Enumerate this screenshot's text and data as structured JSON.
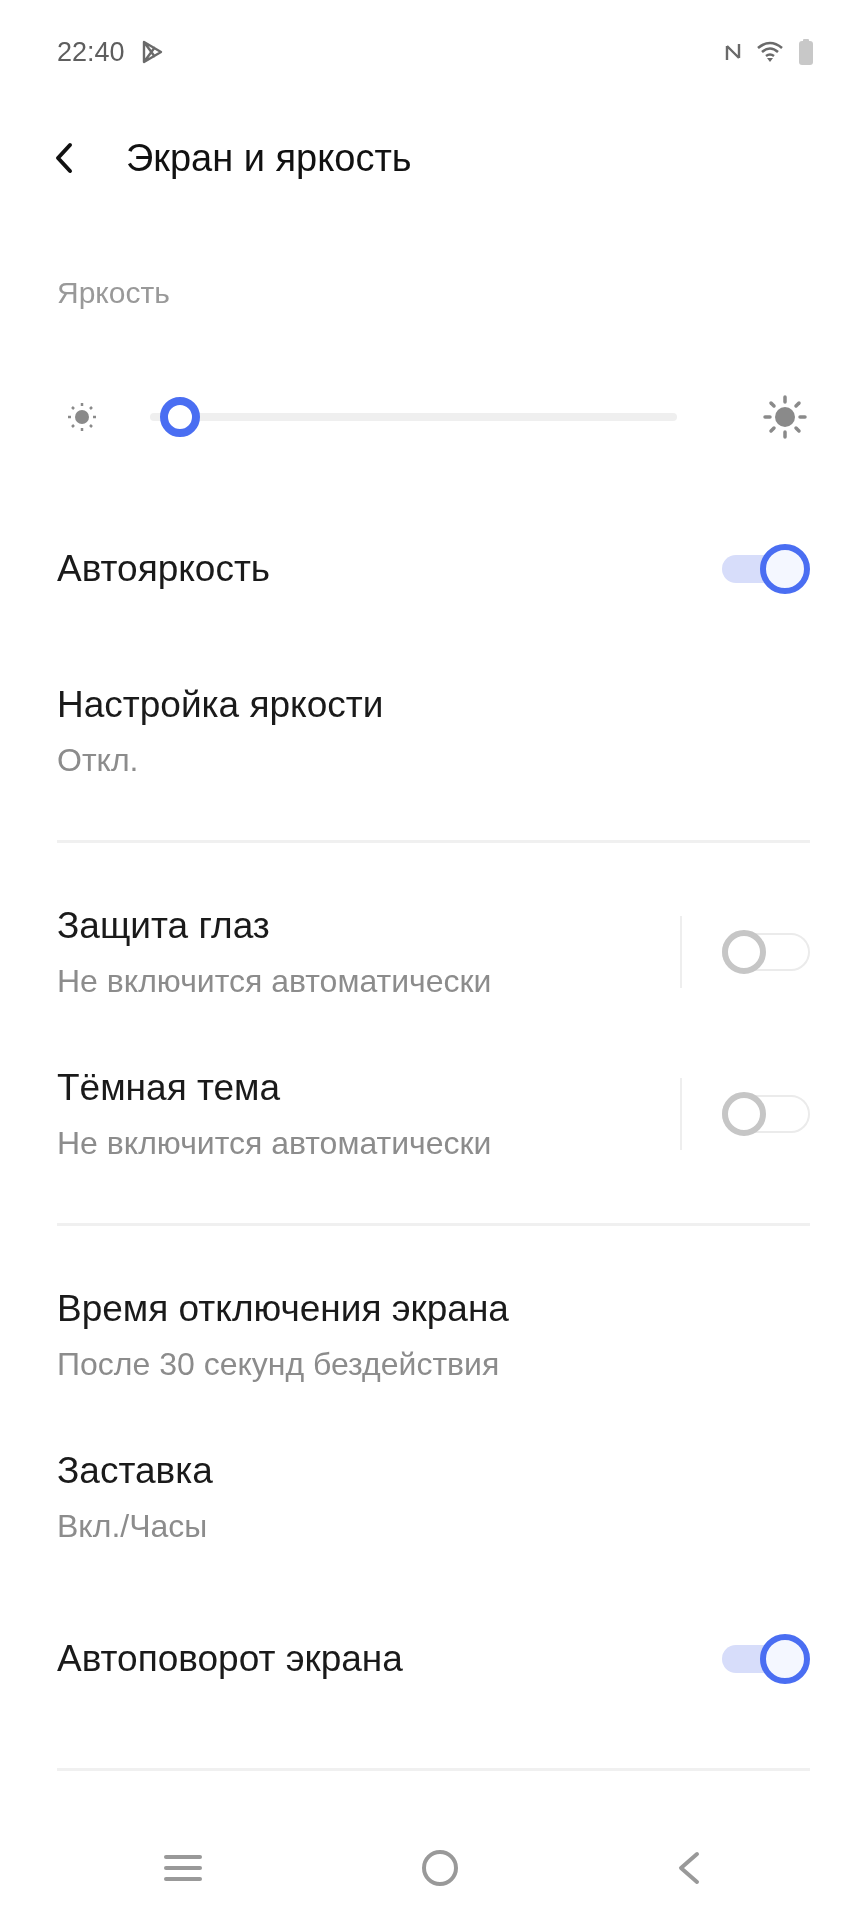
{
  "status_bar": {
    "time": "22:40"
  },
  "header": {
    "title": "Экран и яркость"
  },
  "brightness": {
    "label": "Яркость",
    "level": 0.02
  },
  "sections": [
    {
      "items": [
        {
          "kind": "toggle",
          "title": "Автояркость",
          "on": true
        },
        {
          "kind": "detail",
          "title": "Настройка яркости",
          "value": "Откл."
        }
      ]
    },
    {
      "items": [
        {
          "kind": "toggle_detail",
          "title": "Защита глаз",
          "value": "Не включится автоматически",
          "on": false
        },
        {
          "kind": "toggle_detail",
          "title": "Тёмная тема",
          "value": "Не включится автоматически",
          "on": false
        }
      ]
    },
    {
      "items": [
        {
          "kind": "detail",
          "title": "Время отключения экрана",
          "value": "После 30 секунд бездействия"
        },
        {
          "kind": "detail",
          "title": "Заставка",
          "value": "Вкл./Часы"
        },
        {
          "kind": "toggle",
          "title": "Автоповорот экрана",
          "on": true
        }
      ]
    }
  ]
}
